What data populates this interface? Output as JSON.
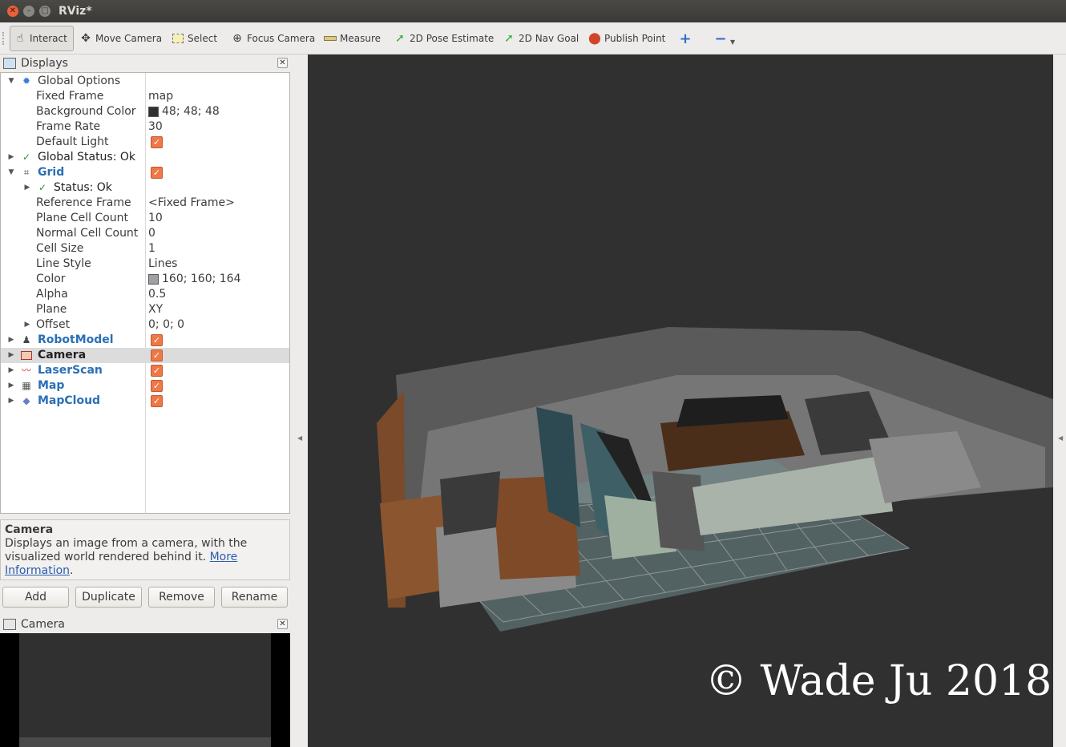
{
  "window": {
    "title": "RViz*"
  },
  "toolbar": {
    "tools": [
      {
        "label": "Interact",
        "icon": "hand-icon"
      },
      {
        "label": "Move Camera",
        "icon": "move-camera-icon"
      },
      {
        "label": "Select",
        "icon": "select-icon"
      },
      {
        "label": "Focus Camera",
        "icon": "focus-camera-icon"
      },
      {
        "label": "Measure",
        "icon": "ruler-icon"
      },
      {
        "label": "2D Pose Estimate",
        "icon": "green-arrow-icon"
      },
      {
        "label": "2D Nav Goal",
        "icon": "green-arrow-icon"
      },
      {
        "label": "Publish Point",
        "icon": "map-pin-icon"
      }
    ]
  },
  "displays_panel": {
    "title": "Displays",
    "global_options": {
      "label": "Global Options",
      "fixed_frame_label": "Fixed Frame",
      "fixed_frame": "map",
      "background_color_label": "Background Color",
      "background_color": "48; 48; 48",
      "background_swatch": "#303030",
      "frame_rate_label": "Frame Rate",
      "frame_rate": "30",
      "default_light_label": "Default Light"
    },
    "global_status": "Global Status: Ok",
    "grid": {
      "label": "Grid",
      "status": "Status: Ok",
      "reference_frame_label": "Reference Frame",
      "reference_frame": "<Fixed Frame>",
      "plane_cell_count_label": "Plane Cell Count",
      "plane_cell_count": "10",
      "normal_cell_count_label": "Normal Cell Count",
      "normal_cell_count": "0",
      "cell_size_label": "Cell Size",
      "cell_size": "1",
      "line_style_label": "Line Style",
      "line_style": "Lines",
      "color_label": "Color",
      "color": "160; 160; 164",
      "color_swatch": "#a0a0a4",
      "alpha_label": "Alpha",
      "alpha": "0.5",
      "plane_label": "Plane",
      "plane": "XY",
      "offset_label": "Offset",
      "offset": "0; 0; 0"
    },
    "displays": [
      {
        "label": "RobotModel",
        "icon": "robot-icon"
      },
      {
        "label": "Camera",
        "icon": "camera-icon"
      },
      {
        "label": "LaserScan",
        "icon": "laser-icon"
      },
      {
        "label": "Map",
        "icon": "map-icon"
      },
      {
        "label": "MapCloud",
        "icon": "cloud-icon"
      }
    ]
  },
  "description": {
    "title": "Camera",
    "text": "Displays an image from a camera, with the visualized world rendered behind it.",
    "link1": "More",
    "link2": "Information",
    "period": "."
  },
  "buttons": {
    "add": "Add",
    "duplicate": "Duplicate",
    "remove": "Remove",
    "rename": "Rename"
  },
  "camera_panel": {
    "title": "Camera"
  },
  "watermark": "© Wade Ju 2018"
}
